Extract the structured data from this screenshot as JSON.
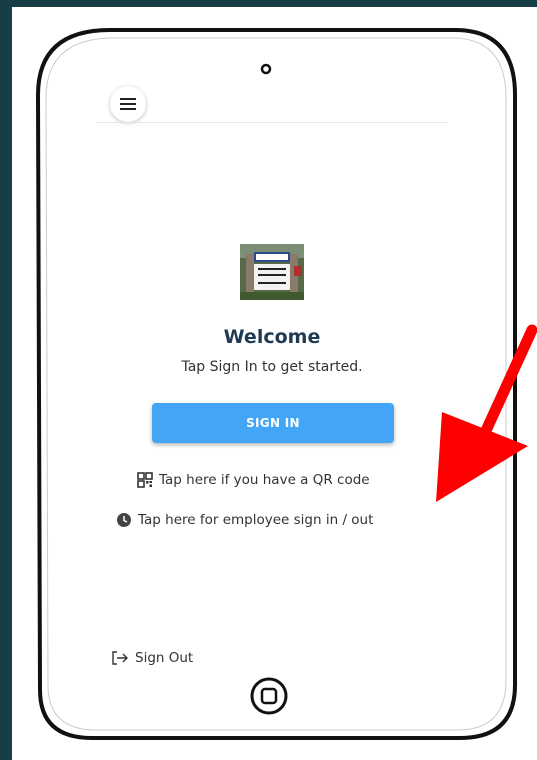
{
  "header": {
    "menu_icon": "hamburger-menu-icon"
  },
  "main": {
    "logo_alt": "VFW Post logo",
    "title": "Welcome",
    "subtitle": "Tap Sign In to get started.",
    "signin_label": "SIGN IN",
    "qr_link": "Tap here if you have a QR code",
    "employee_link": "Tap here for employee sign in / out"
  },
  "footer": {
    "signout_label": "Sign Out"
  },
  "icons": {
    "qr": "qr-code-icon",
    "clock": "clock-icon",
    "signout": "sign-out-icon",
    "home": "home-button-icon",
    "annotation": "red-arrow-annotation"
  },
  "colors": {
    "accent": "#42a5f5",
    "title": "#1f3a52",
    "background_band": "#173d45",
    "annotation": "#ff0000"
  }
}
